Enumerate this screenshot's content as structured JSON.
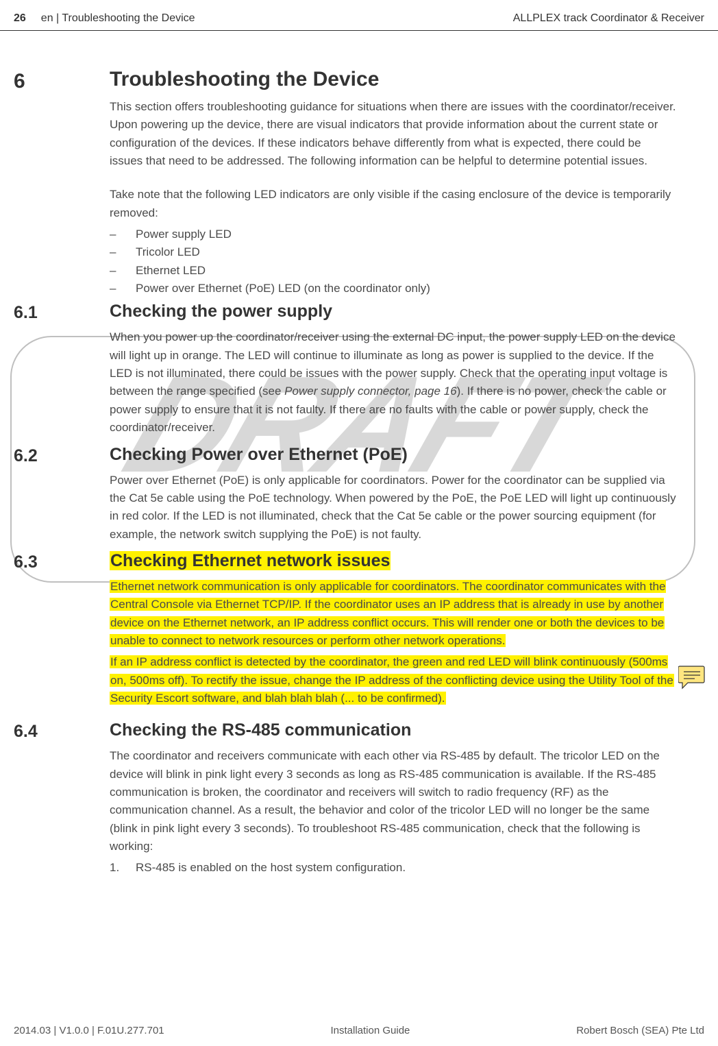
{
  "header": {
    "page_number": "26",
    "path": "en | Troubleshooting the Device",
    "product": "ALLPLEX track Coordinator & Receiver"
  },
  "watermark": "DRAFT",
  "sections": {
    "s6": {
      "num": "6",
      "title": "Troubleshooting the Device",
      "para1": "This section offers troubleshooting guidance for situations when there are issues with the coordinator/receiver. Upon powering up the device, there are visual indicators that provide information about the current state or configuration of the devices. If these indicators behave differently from what is expected, there could be issues that need to be addressed. The following information can be helpful to determine potential issues.",
      "para2": "Take note that the following LED indicators are only visible if the casing enclosure of the device is temporarily removed:",
      "bullets": [
        "Power supply LED",
        "Tricolor LED",
        "Ethernet LED",
        "Power over Ethernet (PoE) LED (on the coordinator only)"
      ]
    },
    "s61": {
      "num": "6.1",
      "title": "Checking the power supply",
      "para_a": "When you power up the coordinator/receiver using the external DC input, the power supply LED on the device will light up in orange. The LED will continue to illuminate as long as power is supplied to the device. If the LED is not illuminated, there could be issues with the power supply. Check that the operating input voltage is between the range specified (see ",
      "ref": "Power supply connector, page 16",
      "para_b": "). If there is no power, check the cable or power supply to ensure that it is not faulty. If there are no faults with the cable or power supply, check the coordinator/receiver."
    },
    "s62": {
      "num": "6.2",
      "title": "Checking Power over Ethernet (PoE)",
      "para": "Power over Ethernet (PoE) is only applicable for coordinators. Power for the coordinator can be supplied via the Cat 5e cable using the PoE technology. When powered by the PoE, the PoE LED will light up continuously in red color. If the LED is not illuminated, check that the Cat 5e cable or the power sourcing equipment (for example, the network switch supplying the PoE) is not faulty."
    },
    "s63": {
      "num": "6.3",
      "title": "Checking Ethernet network issues",
      "para1": "Ethernet network communication is only applicable for coordinators. The coordinator communicates with the Central Console via Ethernet TCP/IP. If the coordinator uses an IP address that is already in use by another device on the Ethernet network, an IP address conflict occurs. This will render one or both the devices to be unable to connect to network resources or perform other network operations.",
      "para2": "If an IP address conflict is detected by the coordinator, the green and red LED will blink continuously (500ms on, 500ms off). To rectify the issue, change the IP address of the conflicting device using the Utility Tool of the Security Escort software, and blah blah blah (... to be confirmed)."
    },
    "s64": {
      "num": "6.4",
      "title": "Checking the RS-485 communication",
      "para": "The coordinator and receivers communicate with each other via RS-485 by default. The tricolor LED on the device will blink in pink light every 3 seconds as long as RS-485 communication is available. If the RS-485 communication is broken, the coordinator and receivers will switch to radio frequency (RF) as the communication channel. As a result, the behavior and color of the tricolor LED will no longer be the same (blink in pink light every 3 seconds). To troubleshoot RS-485 communication, check that the following is working:",
      "list": [
        "RS-485 is enabled on the host system configuration."
      ]
    }
  },
  "footer": {
    "left": "2014.03 | V1.0.0 | F.01U.277.701",
    "center": "Installation Guide",
    "right": "Robert Bosch (SEA) Pte Ltd"
  }
}
